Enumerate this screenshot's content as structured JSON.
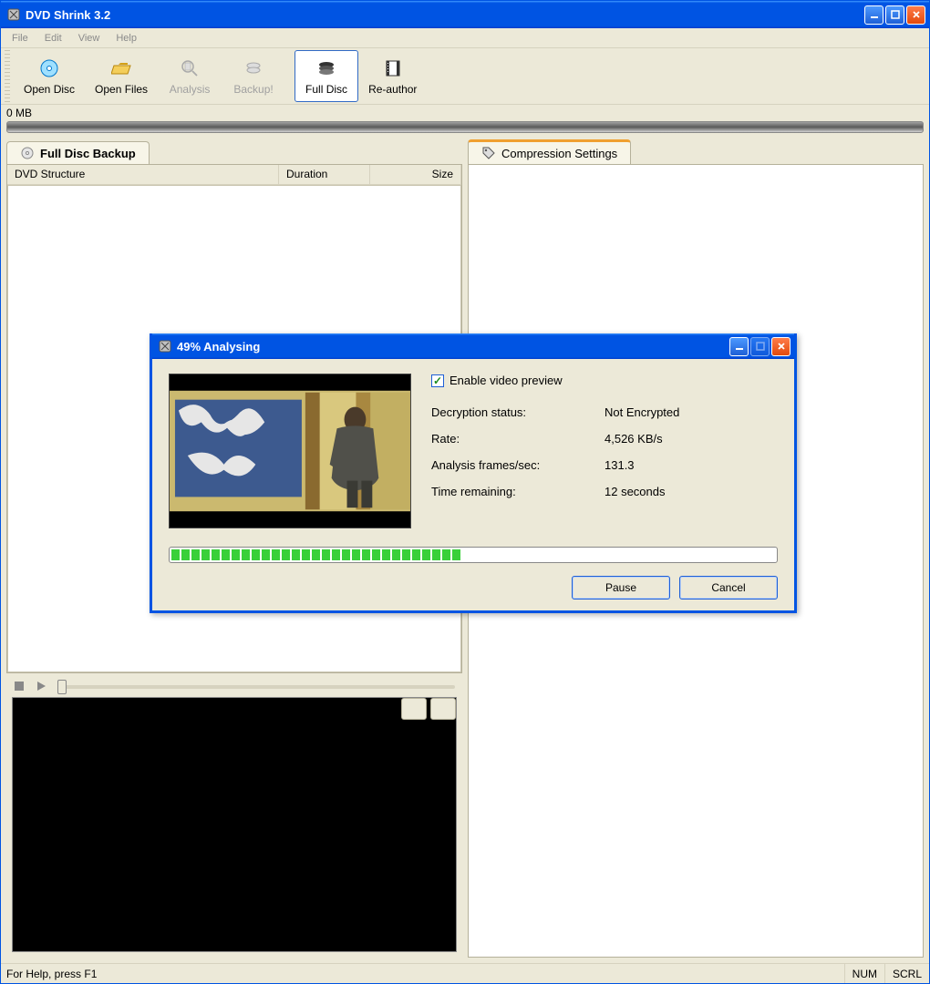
{
  "window": {
    "title": "DVD Shrink 3.2"
  },
  "menu": {
    "file": "File",
    "edit": "Edit",
    "view": "View",
    "help": "Help"
  },
  "toolbar": {
    "open_disc": "Open Disc",
    "open_files": "Open Files",
    "analysis": "Analysis",
    "backup": "Backup!",
    "full_disc": "Full Disc",
    "reauthor": "Re-author"
  },
  "sizebar": {
    "label": "0 MB"
  },
  "left_panel": {
    "title": "Full Disc Backup",
    "col_structure": "DVD Structure",
    "col_duration": "Duration",
    "col_size": "Size"
  },
  "right_panel": {
    "title": "Compression Settings"
  },
  "statusbar": {
    "help": "For Help, press F1",
    "num": "NUM",
    "scrl": "SCRL"
  },
  "dialog": {
    "title": "49% Analysing",
    "enable_preview": "Enable video preview",
    "rows": {
      "decryption_label": "Decryption status:",
      "decryption_value": "Not Encrypted",
      "rate_label": "Rate:",
      "rate_value": "4,526 KB/s",
      "fps_label": "Analysis frames/sec:",
      "fps_value": "131.3",
      "time_label": "Time remaining:",
      "time_value": "12 seconds"
    },
    "progress_percent": 49,
    "pause": "Pause",
    "cancel": "Cancel"
  }
}
